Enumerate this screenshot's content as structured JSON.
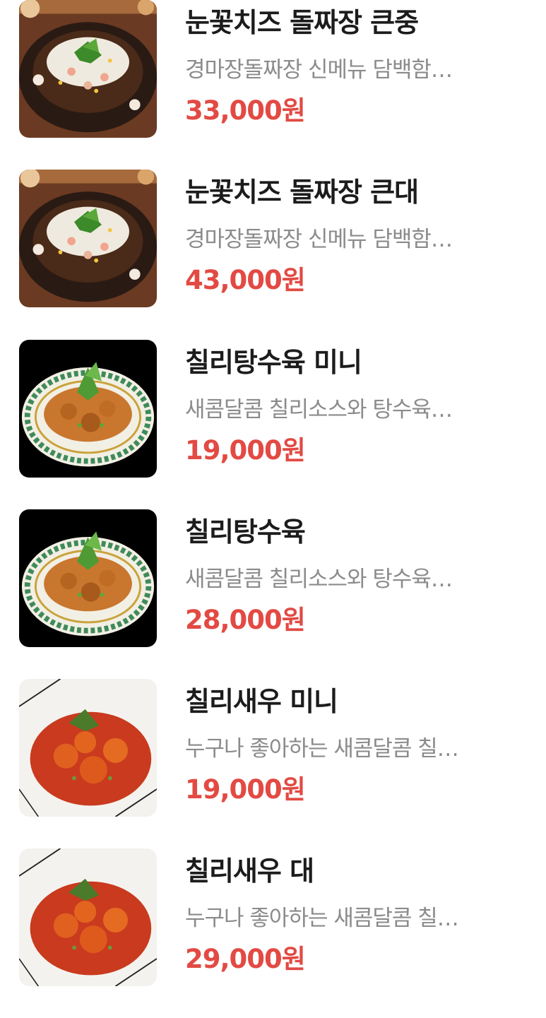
{
  "menu": {
    "items": [
      {
        "name": "눈꽃치즈 돌짜장 큰중",
        "description": "경마장돌짜장 신메뉴 담백함…",
        "price": "33,000원",
        "image": "snow-cheese-jjajang-photo"
      },
      {
        "name": "눈꽃치즈 돌짜장 큰대",
        "description": "경마장돌짜장 신메뉴 담백함…",
        "price": "43,000원",
        "image": "snow-cheese-jjajang-photo"
      },
      {
        "name": "칠리탕수육 미니",
        "description": "새콤달콤 칠리소스와 탕수육…",
        "price": "19,000원",
        "image": "chili-tangsuyuk-photo"
      },
      {
        "name": "칠리탕수육",
        "description": "새콤달콤 칠리소스와 탕수육…",
        "price": "28,000원",
        "image": "chili-tangsuyuk-photo"
      },
      {
        "name": "칠리새우 미니",
        "description": "누구나 좋아하는 새콤달콤 칠…",
        "price": "19,000원",
        "image": "chili-shrimp-photo"
      },
      {
        "name": "칠리새우 대",
        "description": "누구나 좋아하는 새콤달콤 칠…",
        "price": "29,000원",
        "image": "chili-shrimp-photo"
      }
    ]
  },
  "colors": {
    "name": "#1c1c1c",
    "description": "#8b8b8b",
    "price": "#e24a43"
  }
}
